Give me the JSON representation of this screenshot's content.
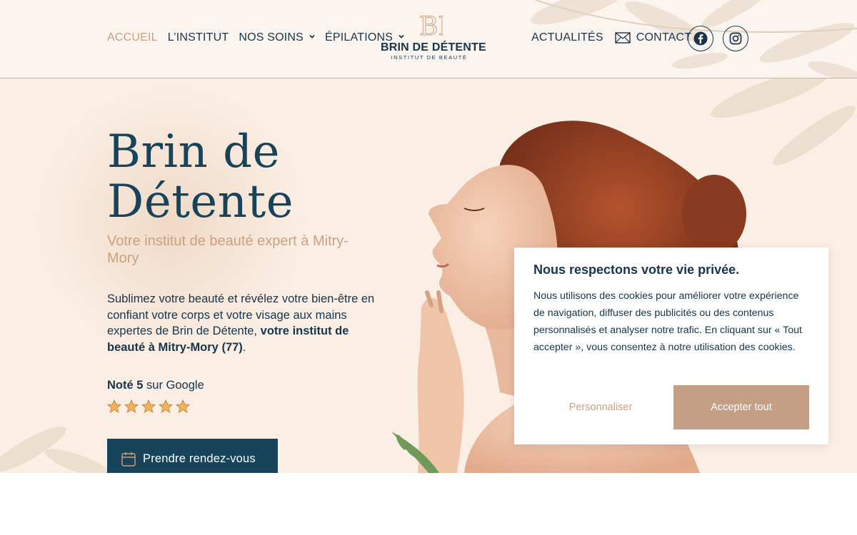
{
  "nav": {
    "accueil": "ACCUEIL",
    "institut": "L’INSTITUT",
    "soins": "NOS SOINS",
    "epilations": "ÉPILATIONS",
    "actualites": "ACTUALITÉS",
    "contact": "CONTACT"
  },
  "logo": {
    "monogram": "BD",
    "name": "BRIN DE DÉTENTE",
    "tagline": "INSTITUT DE BEAUTÉ"
  },
  "hero": {
    "title_line1": "Brin de",
    "title_line2": "Détente",
    "subtitle": "Votre institut de beauté expert à Mitry-Mory",
    "description": "Sublimez votre beauté et révélez votre bien-être en confiant votre corps et votre visage aux mains expertes de Brin de Détente,",
    "description_bold": "votre institut de beauté à Mitry-Mory (77)",
    "description_end": ".",
    "rating_prefix": "Noté 5",
    "rating_suffix": "sur Google",
    "rating_value": 5,
    "cta": "Prendre rendez-vous"
  },
  "cookie": {
    "title": "Nous respectons votre vie privée.",
    "text": "Nous utilisons des cookies pour améliorer votre expérience de navigation, diffuser des publicités ou des contenus personnalisés et analyser notre trafic. En cliquant sur « Tout accepter », vous consentez à notre utilisation des cookies.",
    "customize": "Personnaliser",
    "accept": "Accepter tout"
  },
  "colors": {
    "navy": "#17445a",
    "gold": "#c9a182",
    "cream": "#fbefe5",
    "accept_bg": "#c49f86"
  },
  "icons": {
    "chevron": "chevron-down-icon",
    "mail": "mail-icon",
    "facebook": "facebook-icon",
    "instagram": "instagram-icon",
    "calendar": "calendar-icon",
    "star": "star-icon"
  }
}
